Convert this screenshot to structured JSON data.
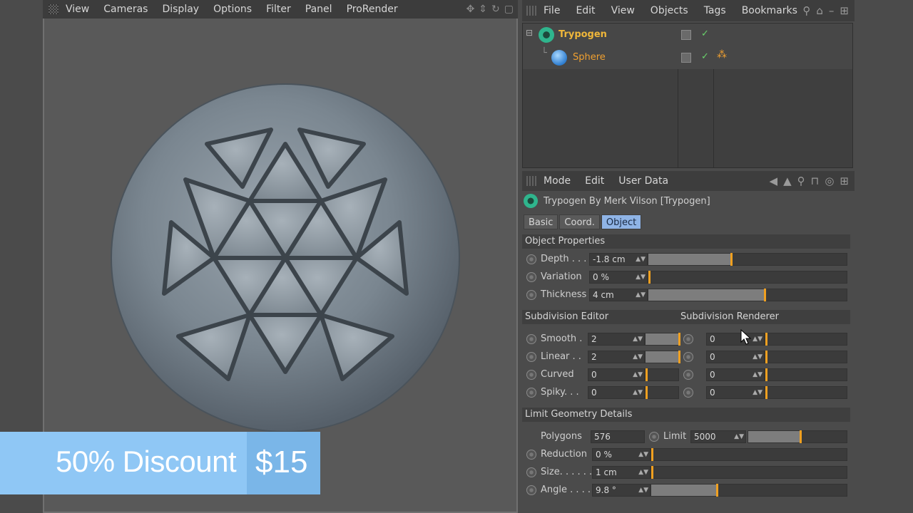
{
  "viewport": {
    "menu": [
      "View",
      "Cameras",
      "Display",
      "Options",
      "Filter",
      "Panel",
      "ProRender"
    ]
  },
  "object_manager": {
    "menu": [
      "File",
      "Edit",
      "View",
      "Objects",
      "Tags",
      "Bookmarks"
    ],
    "objects": [
      {
        "name": "Trypogen",
        "color": "#f0b73a"
      },
      {
        "name": "Sphere",
        "color": "#f0a030"
      }
    ]
  },
  "attribute_manager": {
    "menu": [
      "Mode",
      "Edit",
      "User Data"
    ],
    "title": "Trypogen By Merk Vilson [Trypogen]",
    "tabs": [
      "Basic",
      "Coord.",
      "Object"
    ],
    "active_tab": "Object",
    "sections": {
      "object_properties": "Object Properties",
      "subdivision_editor": "Subdivision Editor",
      "subdivision_renderer": "Subdivision Renderer",
      "limit_geometry": "Limit Geometry Details"
    },
    "object_properties": [
      {
        "label": "Depth . . .",
        "value": "-1.8 cm",
        "level": 0.41
      },
      {
        "label": "Variation",
        "value": "0 %",
        "level": 0.0
      },
      {
        "label": "Thickness",
        "value": "4 cm",
        "level": 0.58
      }
    ],
    "subdivision": [
      {
        "label": "Smooth .",
        "editor": "2",
        "editor_level": 1.0,
        "renderer": "0"
      },
      {
        "label": "Linear . .",
        "editor": "2",
        "editor_level": 1.0,
        "renderer": "0"
      },
      {
        "label": "Curved",
        "editor": "0",
        "editor_level": 0.0,
        "renderer": "0"
      },
      {
        "label": "Spiky. . .",
        "editor": "0",
        "editor_level": 0.0,
        "renderer": "0"
      }
    ],
    "limit": {
      "polygons_label": "Polygons",
      "polygons_value": "576",
      "limit_label": "Limit",
      "limit_value": "5000",
      "limit_level": 0.52,
      "rows": [
        {
          "label": "Reduction",
          "value": "0 %",
          "level": 0.0
        },
        {
          "label": "Size. . . . . .",
          "value": "1 cm",
          "level": 0.0
        },
        {
          "label": "Angle . . . .",
          "value": "9.8 °",
          "level": 0.33
        }
      ]
    }
  },
  "banner": {
    "text": "50% Discount",
    "price": "$15"
  }
}
